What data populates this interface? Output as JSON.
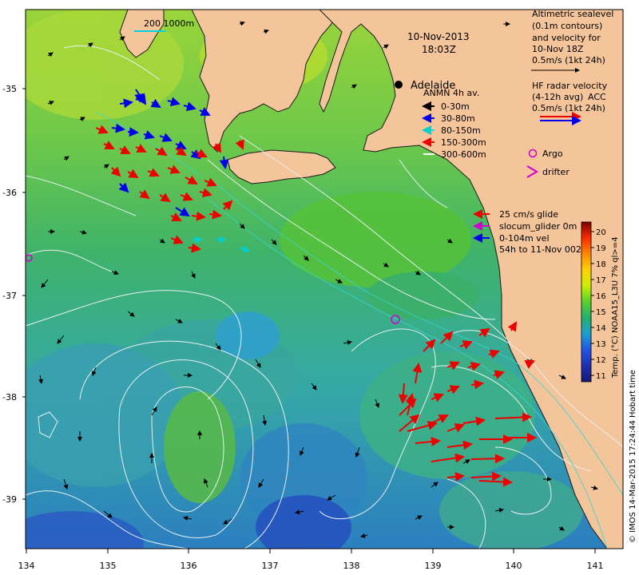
{
  "map": {
    "date": "10-Nov-2013",
    "time": "18:03Z",
    "scale_bar": "200  1000m",
    "place": "Adelaide",
    "lon_labels": [
      "134",
      "135",
      "136",
      "137",
      "138",
      "139",
      "140",
      "141"
    ],
    "lat_labels": [
      "-35",
      "-36",
      "-37",
      "-38",
      "-39"
    ],
    "credit": "© IMOS 14-Mar-2015 17:24:44 Hobart time"
  },
  "legend": {
    "altimetry": [
      "Altimetric sealevel",
      "(0.1m contours)",
      "and velocity for",
      "10-Nov 18Z",
      "0.5m/s (1kt 24h)"
    ],
    "hf_radar": [
      "HF radar velocity",
      "(4-12h avg)",
      "0.5m/s (1kt 24h)"
    ],
    "hf_radar_tag": "ACC",
    "anmn_title": "ANMN 4h av.",
    "anmn": [
      {
        "label": "0-30m",
        "color": "#000000"
      },
      {
        "label": "30-80m",
        "color": "#0000ee"
      },
      {
        "label": "80-150m",
        "color": "#00e5e5"
      },
      {
        "label": "150-300m",
        "color": "#ee0000"
      },
      {
        "label": "300-600m",
        "color": "#ffffff"
      }
    ],
    "argo": "Argo",
    "drifter": "drifter",
    "glider": [
      "25 cm/s glide",
      "slocum_glider 0m",
      "0-104m vel",
      "54h to 11-Nov 002"
    ]
  },
  "colorbar": {
    "label": "Temp. (°C) NOAA15_L3U 7% ql>=4",
    "ticks": [
      "20",
      "19",
      "18",
      "17",
      "16",
      "15",
      "14",
      "13",
      "12",
      "11"
    ],
    "colors": [
      "#7a0000",
      "#c80000",
      "#ff2a00",
      "#ff8a00",
      "#ffd200",
      "#c8f000",
      "#55d22a",
      "#22b070",
      "#1aa0d2",
      "#1f56e6",
      "#1e2fb4",
      "#151a78"
    ]
  },
  "colors": {
    "land": "#f4c49a",
    "coast": "#1a1a1a",
    "contour": "#e8f0f0",
    "glider": "#d000d0"
  }
}
